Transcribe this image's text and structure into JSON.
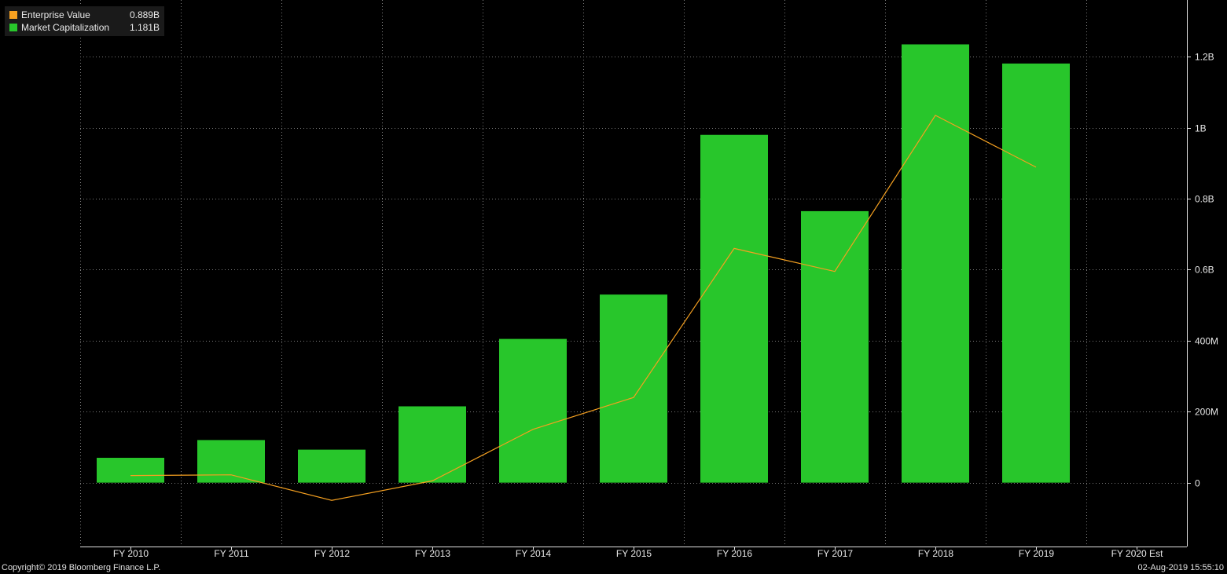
{
  "chart_data": {
    "type": "bar",
    "categories": [
      "FY 2010",
      "FY 2011",
      "FY 2012",
      "FY 2013",
      "FY 2014",
      "FY 2015",
      "FY 2016",
      "FY 2017",
      "FY 2018",
      "FY 2019",
      "FY 2020 Est"
    ],
    "series": [
      {
        "name": "Market Capitalization",
        "type": "bar",
        "color": "#28c62b",
        "values": [
          70000000,
          120000000,
          93000000,
          215000000,
          405000000,
          530000000,
          980000000,
          765000000,
          1235000000,
          1181000000,
          null
        ]
      },
      {
        "name": "Enterprise Value",
        "type": "line",
        "color": "#f5a020",
        "values": [
          20000000,
          22000000,
          -50000000,
          5000000,
          150000000,
          240000000,
          660000000,
          595000000,
          1035000000,
          889000000,
          null
        ]
      }
    ],
    "ylim": [
      -180000000,
      1360000000
    ],
    "yticks": [
      {
        "value": 0,
        "label": "0"
      },
      {
        "value": 200000000,
        "label": "200M"
      },
      {
        "value": 400000000,
        "label": "400M"
      },
      {
        "value": 600000000,
        "label": "0.6B"
      },
      {
        "value": 800000000,
        "label": "0.8B"
      },
      {
        "value": 1000000000,
        "label": "1B"
      },
      {
        "value": 1200000000,
        "label": "1.2B"
      }
    ],
    "y_axis_position": "right",
    "grid": true,
    "legend_position": "top-left"
  },
  "legend": [
    {
      "name": "Enterprise Value",
      "value": "0.889B",
      "color": "#f5a020"
    },
    {
      "name": "Market Capitalization",
      "value": "1.181B",
      "color": "#28c62b"
    }
  ],
  "footer": {
    "copyright": "Copyright© 2019 Bloomberg Finance L.P.",
    "timestamp": "02-Aug-2019 15:55:10"
  }
}
